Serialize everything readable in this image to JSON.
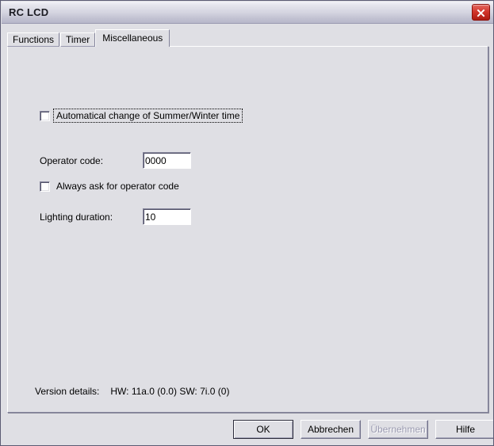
{
  "window": {
    "title": "RC LCD",
    "close_icon": "close-icon"
  },
  "tabs": [
    {
      "label": "Functions",
      "active": false
    },
    {
      "label": "Timer",
      "active": false
    },
    {
      "label": "Miscellaneous",
      "active": true
    }
  ],
  "form": {
    "summer_winter": {
      "label": "Automatical change of Summer/Winter time",
      "checked": false,
      "focused": true
    },
    "operator_code": {
      "label": "Operator code:",
      "value": "0000",
      "placeholder": ""
    },
    "always_ask": {
      "label": "Always ask for operator code",
      "checked": false
    },
    "lighting_duration": {
      "label": "Lighting duration:",
      "value": "10",
      "placeholder": ""
    }
  },
  "version": {
    "label": "Version details:",
    "value": "HW: 11a.0 (0.0)  SW: 7i.0 (0)"
  },
  "buttons": {
    "ok": "OK",
    "cancel": "Abbrechen",
    "apply": "Übernehmen",
    "help": "Hilfe"
  },
  "colors": {
    "dialog_face": "#dfdfe4",
    "title_text": "#1b1b22",
    "close_button": "#d2352b",
    "disabled_text": "#9a9ab0"
  }
}
